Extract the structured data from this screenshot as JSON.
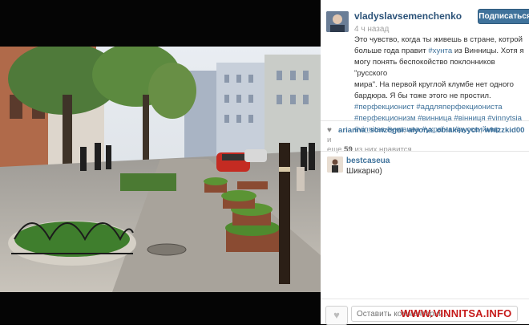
{
  "post": {
    "username": "vladyslavsemenchenko",
    "time": "4 ч назад",
    "follow_label": "Подписаться",
    "caption": {
      "l1": "Это чувство, когда ты живешь в стране, котрой",
      "l2a": "больше года правит ",
      "tag_junta": "#хунта",
      "l2b": " из Винницы. Хотя я",
      "l3": "могу понять беспокойство поклонников \"русского",
      "l4": "мира\". На первой круглой клумбе нет одного",
      "l5": "бардюра. Я бы тоже этого не простил.",
      "tags1a": "#перфекционист",
      "tags1b": "#аддляперфекциониста",
      "tags2a": "#перфекционизм",
      "tags2b": "#винница",
      "tags2c": "#вінниця",
      "tags2d": "#vinnytsia",
      "tags3a": "#vinnitsa",
      "tags3b": "#украина",
      "tags3c": "#україна",
      "tags3d": "#русскиймир"
    }
  },
  "likes": {
    "users": [
      "arianna_sonzogni",
      "alyona_oblakewych",
      "whizzkid00"
    ],
    "suffix": "и",
    "more_prefix": "еще",
    "more_count": "59",
    "more_suffix": "из них нравится."
  },
  "comments": [
    {
      "user": "bestcaseua",
      "text": "Шикарно)"
    }
  ],
  "comment_box": {
    "placeholder": "Оставить комментарий..."
  },
  "watermark": "WWW.VINNITSA.INFO",
  "icons": {
    "heart": "heart-icon",
    "avatar": "avatar"
  }
}
